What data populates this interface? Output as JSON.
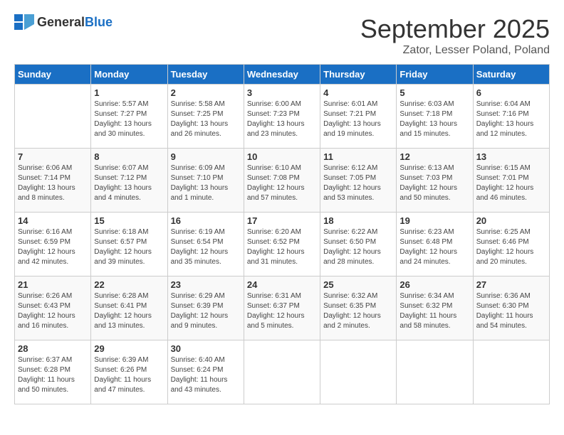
{
  "header": {
    "logo_general": "General",
    "logo_blue": "Blue",
    "title": "September 2025",
    "subtitle": "Zator, Lesser Poland, Poland"
  },
  "weekdays": [
    "Sunday",
    "Monday",
    "Tuesday",
    "Wednesday",
    "Thursday",
    "Friday",
    "Saturday"
  ],
  "weeks": [
    [
      {
        "day": "",
        "info": ""
      },
      {
        "day": "1",
        "info": "Sunrise: 5:57 AM\nSunset: 7:27 PM\nDaylight: 13 hours\nand 30 minutes."
      },
      {
        "day": "2",
        "info": "Sunrise: 5:58 AM\nSunset: 7:25 PM\nDaylight: 13 hours\nand 26 minutes."
      },
      {
        "day": "3",
        "info": "Sunrise: 6:00 AM\nSunset: 7:23 PM\nDaylight: 13 hours\nand 23 minutes."
      },
      {
        "day": "4",
        "info": "Sunrise: 6:01 AM\nSunset: 7:21 PM\nDaylight: 13 hours\nand 19 minutes."
      },
      {
        "day": "5",
        "info": "Sunrise: 6:03 AM\nSunset: 7:18 PM\nDaylight: 13 hours\nand 15 minutes."
      },
      {
        "day": "6",
        "info": "Sunrise: 6:04 AM\nSunset: 7:16 PM\nDaylight: 13 hours\nand 12 minutes."
      }
    ],
    [
      {
        "day": "7",
        "info": "Sunrise: 6:06 AM\nSunset: 7:14 PM\nDaylight: 13 hours\nand 8 minutes."
      },
      {
        "day": "8",
        "info": "Sunrise: 6:07 AM\nSunset: 7:12 PM\nDaylight: 13 hours\nand 4 minutes."
      },
      {
        "day": "9",
        "info": "Sunrise: 6:09 AM\nSunset: 7:10 PM\nDaylight: 13 hours\nand 1 minute."
      },
      {
        "day": "10",
        "info": "Sunrise: 6:10 AM\nSunset: 7:08 PM\nDaylight: 12 hours\nand 57 minutes."
      },
      {
        "day": "11",
        "info": "Sunrise: 6:12 AM\nSunset: 7:05 PM\nDaylight: 12 hours\nand 53 minutes."
      },
      {
        "day": "12",
        "info": "Sunrise: 6:13 AM\nSunset: 7:03 PM\nDaylight: 12 hours\nand 50 minutes."
      },
      {
        "day": "13",
        "info": "Sunrise: 6:15 AM\nSunset: 7:01 PM\nDaylight: 12 hours\nand 46 minutes."
      }
    ],
    [
      {
        "day": "14",
        "info": "Sunrise: 6:16 AM\nSunset: 6:59 PM\nDaylight: 12 hours\nand 42 minutes."
      },
      {
        "day": "15",
        "info": "Sunrise: 6:18 AM\nSunset: 6:57 PM\nDaylight: 12 hours\nand 39 minutes."
      },
      {
        "day": "16",
        "info": "Sunrise: 6:19 AM\nSunset: 6:54 PM\nDaylight: 12 hours\nand 35 minutes."
      },
      {
        "day": "17",
        "info": "Sunrise: 6:20 AM\nSunset: 6:52 PM\nDaylight: 12 hours\nand 31 minutes."
      },
      {
        "day": "18",
        "info": "Sunrise: 6:22 AM\nSunset: 6:50 PM\nDaylight: 12 hours\nand 28 minutes."
      },
      {
        "day": "19",
        "info": "Sunrise: 6:23 AM\nSunset: 6:48 PM\nDaylight: 12 hours\nand 24 minutes."
      },
      {
        "day": "20",
        "info": "Sunrise: 6:25 AM\nSunset: 6:46 PM\nDaylight: 12 hours\nand 20 minutes."
      }
    ],
    [
      {
        "day": "21",
        "info": "Sunrise: 6:26 AM\nSunset: 6:43 PM\nDaylight: 12 hours\nand 16 minutes."
      },
      {
        "day": "22",
        "info": "Sunrise: 6:28 AM\nSunset: 6:41 PM\nDaylight: 12 hours\nand 13 minutes."
      },
      {
        "day": "23",
        "info": "Sunrise: 6:29 AM\nSunset: 6:39 PM\nDaylight: 12 hours\nand 9 minutes."
      },
      {
        "day": "24",
        "info": "Sunrise: 6:31 AM\nSunset: 6:37 PM\nDaylight: 12 hours\nand 5 minutes."
      },
      {
        "day": "25",
        "info": "Sunrise: 6:32 AM\nSunset: 6:35 PM\nDaylight: 12 hours\nand 2 minutes."
      },
      {
        "day": "26",
        "info": "Sunrise: 6:34 AM\nSunset: 6:32 PM\nDaylight: 11 hours\nand 58 minutes."
      },
      {
        "day": "27",
        "info": "Sunrise: 6:36 AM\nSunset: 6:30 PM\nDaylight: 11 hours\nand 54 minutes."
      }
    ],
    [
      {
        "day": "28",
        "info": "Sunrise: 6:37 AM\nSunset: 6:28 PM\nDaylight: 11 hours\nand 50 minutes."
      },
      {
        "day": "29",
        "info": "Sunrise: 6:39 AM\nSunset: 6:26 PM\nDaylight: 11 hours\nand 47 minutes."
      },
      {
        "day": "30",
        "info": "Sunrise: 6:40 AM\nSunset: 6:24 PM\nDaylight: 11 hours\nand 43 minutes."
      },
      {
        "day": "",
        "info": ""
      },
      {
        "day": "",
        "info": ""
      },
      {
        "day": "",
        "info": ""
      },
      {
        "day": "",
        "info": ""
      }
    ]
  ]
}
